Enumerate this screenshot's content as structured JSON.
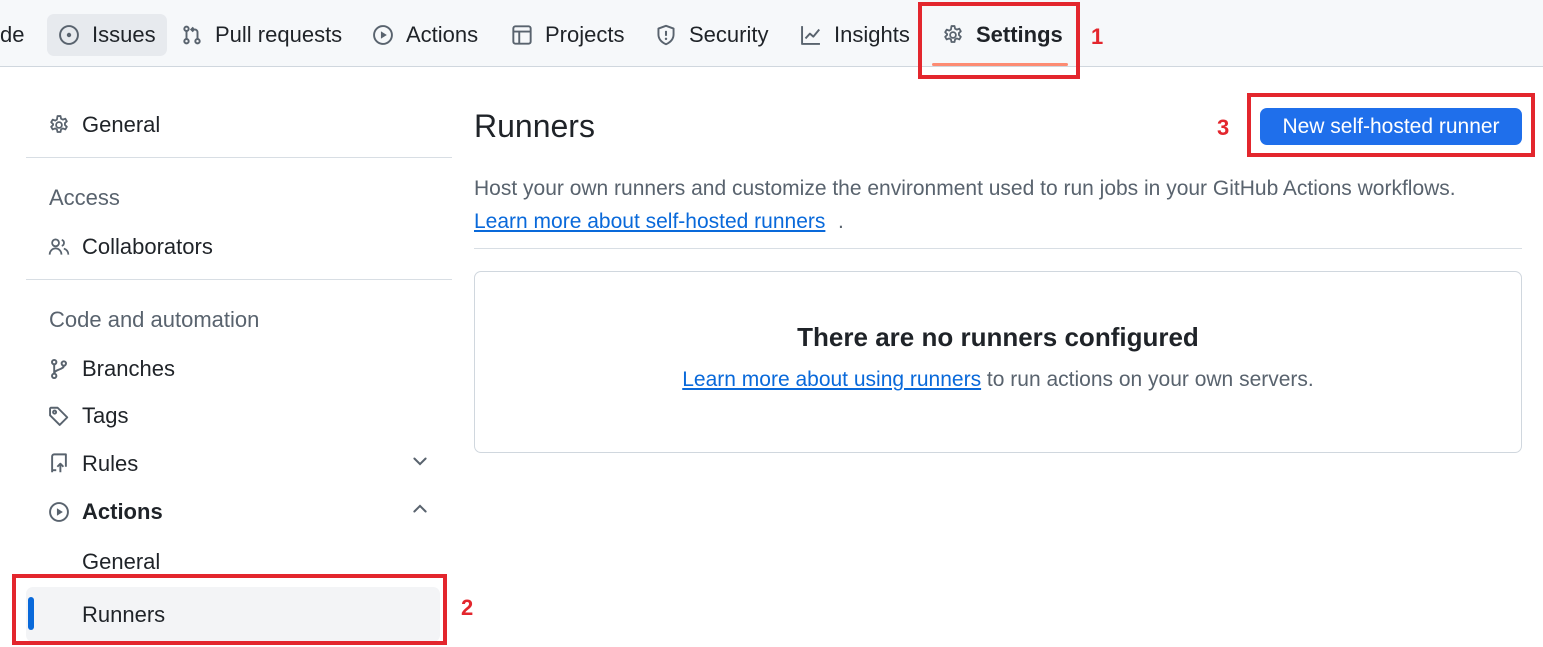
{
  "topnav": {
    "code_partial": "de",
    "issues": "Issues",
    "pull_requests": "Pull requests",
    "actions": "Actions",
    "projects": "Projects",
    "security": "Security",
    "insights": "Insights",
    "settings": "Settings",
    "underline_color": "#fd8c73"
  },
  "sidebar": {
    "general": "General",
    "access_heading": "Access",
    "collaborators": "Collaborators",
    "code_automation_heading": "Code and automation",
    "branches": "Branches",
    "tags": "Tags",
    "rules": "Rules",
    "actions": "Actions",
    "actions_general": "General",
    "actions_runners": "Runners",
    "active_indicator_color": "#0969da"
  },
  "main": {
    "title": "Runners",
    "new_runner_button": "New self-hosted runner",
    "description": "Host your own runners and customize the environment used to run jobs in your GitHub Actions workflows.",
    "learn_more_link": "Learn more about self-hosted runners",
    "learn_more_suffix": ".",
    "empty_title": "There are no runners configured",
    "empty_link": "Learn more about using runners",
    "empty_text_suffix": " to run actions on your own servers.",
    "button_color": "#1f6feb"
  },
  "annotations": {
    "step1": "1",
    "step2": "2",
    "step3": "3",
    "color": "#e3262d"
  }
}
